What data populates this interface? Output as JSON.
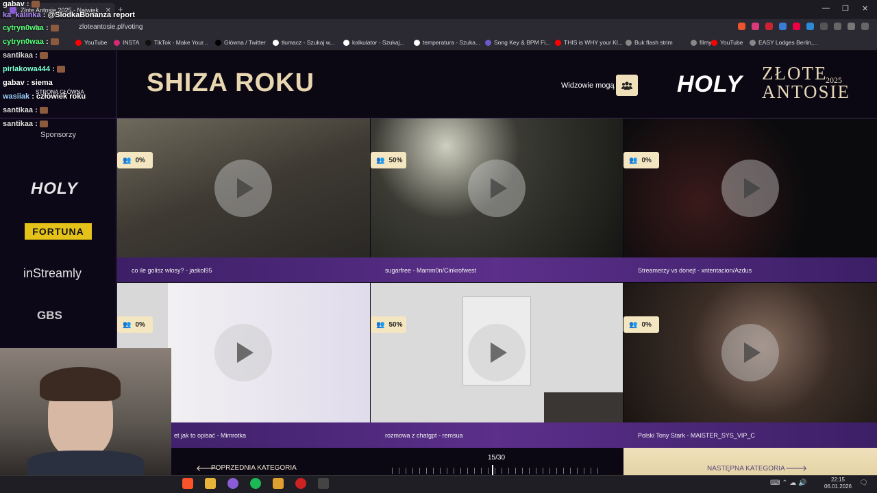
{
  "browser": {
    "tab_title": "Złote Antosie 2025 - Najwięk",
    "url": "zloteantosie.pl/voting",
    "bookmarks": [
      {
        "label": "YouTube",
        "color": "#ff0000"
      },
      {
        "label": "INSTA",
        "color": "#d62976"
      },
      {
        "label": "TikTok - Make Your...",
        "color": "#111111"
      },
      {
        "label": "Główna / Twitter",
        "color": "#000000"
      },
      {
        "label": "tłumacz - Szukaj w...",
        "color": "#ffffff"
      },
      {
        "label": "kalkulator - Szukaj...",
        "color": "#ffffff"
      },
      {
        "label": "temperatura - Szuka...",
        "color": "#ffffff"
      },
      {
        "label": "Song Key & BPM Fi...",
        "color": "#6a5acd"
      },
      {
        "label": "THIS is WHY your Kl...",
        "color": "#ff0000"
      },
      {
        "label": "Buk flash strim",
        "color": "#888888"
      },
      {
        "label": "filmy",
        "color": "#888888"
      },
      {
        "label": "YouTube",
        "color": "#ff0000"
      },
      {
        "label": "EASY Lodges Berlin,...",
        "color": "#888888"
      }
    ]
  },
  "header": {
    "title": "SHIZA ROKU",
    "viewers_label": "Widzowie mogą",
    "brand_holy": "HOLY",
    "brand_line1": "ZŁOTE",
    "brand_line2": "ANTOSIE",
    "brand_year": "2025"
  },
  "sidebar": {
    "home_label": "STRONA GŁÓWNA",
    "sponsors_label": "Sponsorzy",
    "sponsors": [
      "HOLY",
      "FORTUNA",
      "inStreamly",
      "GBS"
    ]
  },
  "cards": [
    {
      "percent": "0%",
      "caption": "co ile golisz włosy? - jaskol95"
    },
    {
      "percent": "50%",
      "caption": "sugarfree - Mamm0n/Cinkrofwest"
    },
    {
      "percent": "0%",
      "caption": "Streamerzy vs donejt - xntentacion/Azdus"
    },
    {
      "percent": "0%",
      "caption": "et jak to opisać - Mimrotka"
    },
    {
      "percent": "50%",
      "caption": "rozmowa z chatgpt - remsua"
    },
    {
      "percent": "0%",
      "caption": "Polski Tony Stark - MAISTER_SYS_VIP_C"
    }
  ],
  "nav": {
    "prev_label": "POPRZEDNIA KATEGORIA",
    "next_label": "NASTĘPNA KATEGORIA",
    "counter": "15/30"
  },
  "chat": [
    {
      "user": "gabav",
      "text": "",
      "color": "#ffffff",
      "emote": true
    },
    {
      "user": "ka_kalinka",
      "text": "@SlodkaBonanza report",
      "color": "#b48cff",
      "emote": false
    },
    {
      "user": "cytryn0waa",
      "text": "",
      "color": "#55ff77",
      "emote": true
    },
    {
      "user": "cytryn0waa",
      "text": "",
      "color": "#55ff77",
      "emote": true
    },
    {
      "user": "santikaa",
      "text": "",
      "color": "#e0e0e0",
      "emote": true
    },
    {
      "user": "pirlakowa444",
      "text": "",
      "color": "#7fffd4",
      "emote": true
    },
    {
      "user": "gabav",
      "text": "siema",
      "color": "#ffffff",
      "emote": false
    },
    {
      "user": "wasiiak",
      "text": "człowiek roku",
      "color": "#9ad0ff",
      "emote": false
    },
    {
      "user": "santikaa",
      "text": "",
      "color": "#e0e0e0",
      "emote": true
    },
    {
      "user": "santikaa",
      "text": "",
      "color": "#e0e0e0",
      "emote": true
    }
  ],
  "taskbar": {
    "time": "22:15",
    "date": "06.01.2026"
  }
}
